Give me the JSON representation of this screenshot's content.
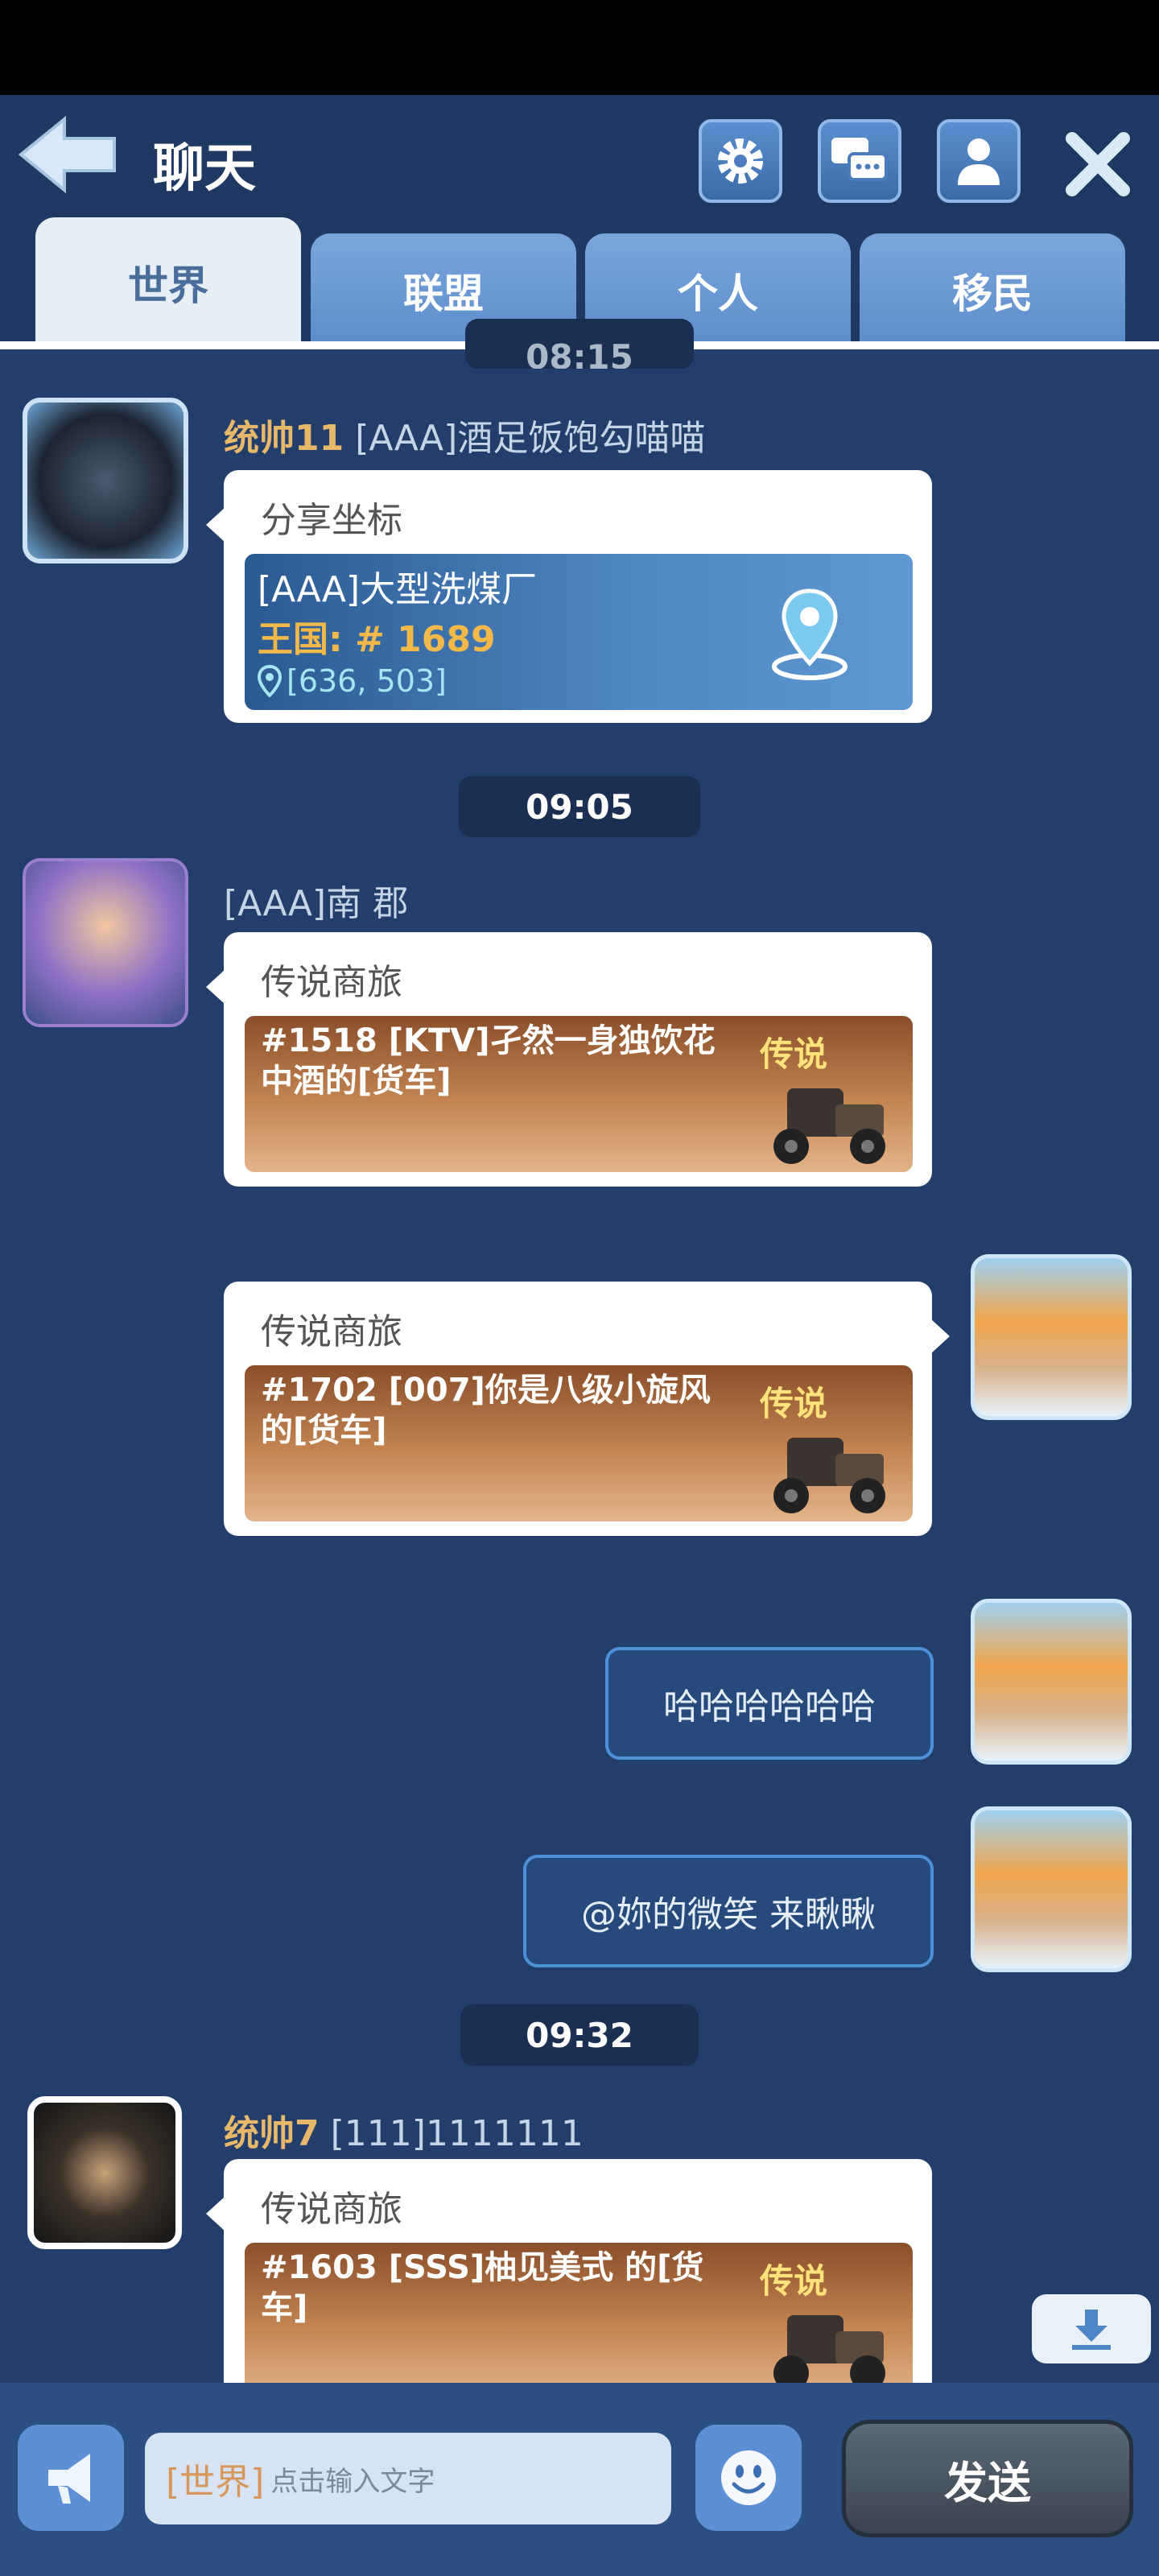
{
  "header": {
    "title": "聊天",
    "tabs": [
      "世界",
      "联盟",
      "个人",
      "移民"
    ],
    "active_tab": 0
  },
  "timestamps": {
    "partial": "08:15",
    "t1": "09:05",
    "t2": "09:32"
  },
  "messages": {
    "m1": {
      "rank": "统帅11",
      "name": "[AAA]酒足饭饱勾喵喵",
      "card_title": "分享坐标",
      "place": "[AAA]大型洗煤厂",
      "kingdom_label": "王国:",
      "kingdom_num": "# 1689",
      "coords": "[636, 503]"
    },
    "m2": {
      "name": "[AAA]南 郡",
      "card_title": "传说商旅",
      "text": "#1518 [KTV]孑然一身独饮花中酒的[货车]",
      "badge": "传说"
    },
    "m3": {
      "card_title": "传说商旅",
      "text": "#1702 [007]你是八级小旋风 的[货车]",
      "badge": "传说"
    },
    "m4": {
      "text": "哈哈哈哈哈哈"
    },
    "m5": {
      "text": "@妳的微笑 来瞅瞅"
    },
    "m6": {
      "rank": "统帅7",
      "name": "[111]1111111",
      "card_title": "传说商旅",
      "text": "#1603 [SSS]柚见美式 的[货车]",
      "badge": "传说"
    }
  },
  "input": {
    "channel_prefix": "[世界]",
    "placeholder": "点击输入文字"
  },
  "send_label": "发送",
  "icons": [
    "back-arrow-icon",
    "gear-icon",
    "chat-bubbles-icon",
    "person-icon",
    "close-icon",
    "map-pin-icon",
    "megaphone-icon",
    "smiley-icon",
    "download-icon"
  ]
}
